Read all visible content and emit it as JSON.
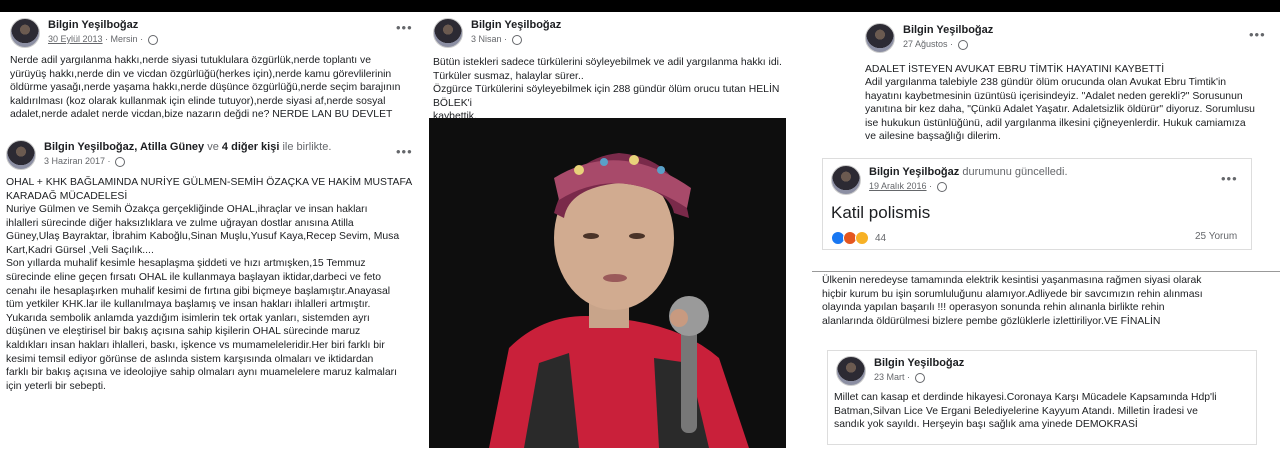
{
  "card1": {
    "author": "Bilgin Yeşilboğaz",
    "date": "30 Eylül 2013",
    "location": "Mersin",
    "text": "Nerde adil yargılanma hakkı,nerde siyasi tutuklulara özgürlük,nerde toplantı ve\nyürüyüş hakkı,nerde din ve vicdan özgürlüğü(herkes için),nerde kamu görevlilerinin\nöldürme yasağı,nerde yaşama hakkı,nerde düşünce özgürlüğü,nerde seçim barajının\nkaldırılması (koz olarak kullanmak için elinde tutuyor),nerde siyasi af,nerde sosyal\nadalet,nerde adalet nerde vicdan,bize nazarın değdi ne?  NERDE LAN BU DEVLET"
  },
  "card2": {
    "author": "Bilgin Yeşilboğaz",
    "with_1": "Atilla Güney",
    "with_conj": "ve",
    "with_2": "4 diğer kişi",
    "with_suffix": "ile birlikte.",
    "date": "3 Haziran 2017",
    "title": "OHAL + KHK BAĞLAMINDA NURİYE GÜLMEN-SEMİH ÖZAÇKA VE HAKİM MUSTAFA\nKARADAĞ MÜCADELESİ",
    "text": "Nuriye Gülmen ve Semih Özakça gerçekliğinde OHAL,ihraçlar ve insan hakları\nihlalleri sürecinde diğer haksızlıklara ve zulme uğrayan dostlar anısına Atilla\nGüney,Ulaş Bayraktar, İbrahim Kaboğlu,Sinan Muşlu,Yusuf Kaya,Recep Sevim, Musa\nKart,Kadri Gürsel ,Veli Saçılık....\nSon yıllarda muhalif kesimle hesaplaşma şiddeti ve hızı artmışken,15 Temmuz\nsürecinde eline geçen fırsatı OHAL ile kullanmaya başlayan iktidar,darbeci ve feto\ncenahı ile hesaplaşırken muhalif kesimi de fırtına gibi biçmeye başlamıştır.Anayasal\ntüm yetkiler KHK.lar ile kullanılmaya başlamış ve insan hakları ihlalleri artmıştır.\nYukarıda sembolik anlamda yazdığım isimlerin tek ortak yanları, sistemden ayrı\ndüşünen ve eleştirisel bir bakış açısına sahip kişilerin OHAL sürecinde maruz\nkaldıkları insan hakları ihlalleri, baskı, işkence vs mumameleleridir.Her biri farklı bir\nkesimi temsil ediyor görünse de aslında sistem karşısında olmaları ve iktidardan\nfarklı bir bakış açısına ve ideolojiye sahip olmaları aynı muamelelere maruz kalmaları\niçin yeterli bir sebepti."
  },
  "card3": {
    "author": "Bilgin Yeşilboğaz",
    "date": "3 Nisan",
    "text": "Bütün istekleri sadece türkülerini söyleyebilmek ve adil yargılanma hakkı idi.\nTürküler susmaz, halaylar sürer..\nÖzgürce Türkülerini söyleyebilmek için 288 gündür ölüm orucu tutan HELİN BÖLEK'i\nkaybettik."
  },
  "card4": {
    "author": "Bilgin Yeşilboğaz",
    "date": "27 Ağustos",
    "title": "ADALET İSTEYEN AVUKAT EBRU TİMTİK HAYATINI KAYBETTİ",
    "text": "Adil yargılanma talebiyle 238 gündür ölüm orucunda olan Avukat Ebru Timtik'in\nhayatını kaybetmesinin üzüntüsü içerisindeyiz. \"Adalet neden gerekli?\" Sorusunun\nyanıtına bir kez daha, \"Çünkü Adalet Yaşatır. Adaletsizlik öldürür\" diyoruz. Sorumlusu\nise hukukun üstünlüğünü, adil yargılanma ilkesini çiğneyenlerdir. Hukuk camiamıza\nve ailesine başsağlığı dilerim."
  },
  "card5": {
    "author": "Bilgin Yeşilboğaz",
    "action": "durumunu güncelledi.",
    "date": "19 Aralık 2016",
    "status": "Katil polismis",
    "reaction_count": "44",
    "comments": "25 Yorum"
  },
  "card6": {
    "text": "Ülkenin neredeyse tamamında elektrik kesintisi yaşanmasına rağmen siyasi olarak\nhiçbir kurum bu işin sorumluluğunu alamıyor.Adliyede bir savcımızın rehin alınması\nolayında yapılan başarılı !!! operasyon sonunda  rehin alınanla birlikte rehin\nalanlarında öldürülmesi bizlere pembe gözlüklerle izlettiriliyor.VE FİNALİN"
  },
  "card7": {
    "author": "Bilgin Yeşilboğaz",
    "date": "23 Mart",
    "text": "Millet can kasap et derdinde hikayesi.Coronaya Karşı Mücadele Kapsamında Hdp'li\nBatman,Silvan Lice Ve Ergani Belediyelerine Kayyum Atandı.  Milletin İradesi ve\nsandık yok sayıldı. Herşeyin başı sağlık ama yinede DEMOKRASİ"
  },
  "icons": {
    "more": "more-options-icon",
    "privacy": "globe-icon",
    "reactions": [
      "like-icon",
      "angry-icon",
      "sad-icon"
    ]
  }
}
